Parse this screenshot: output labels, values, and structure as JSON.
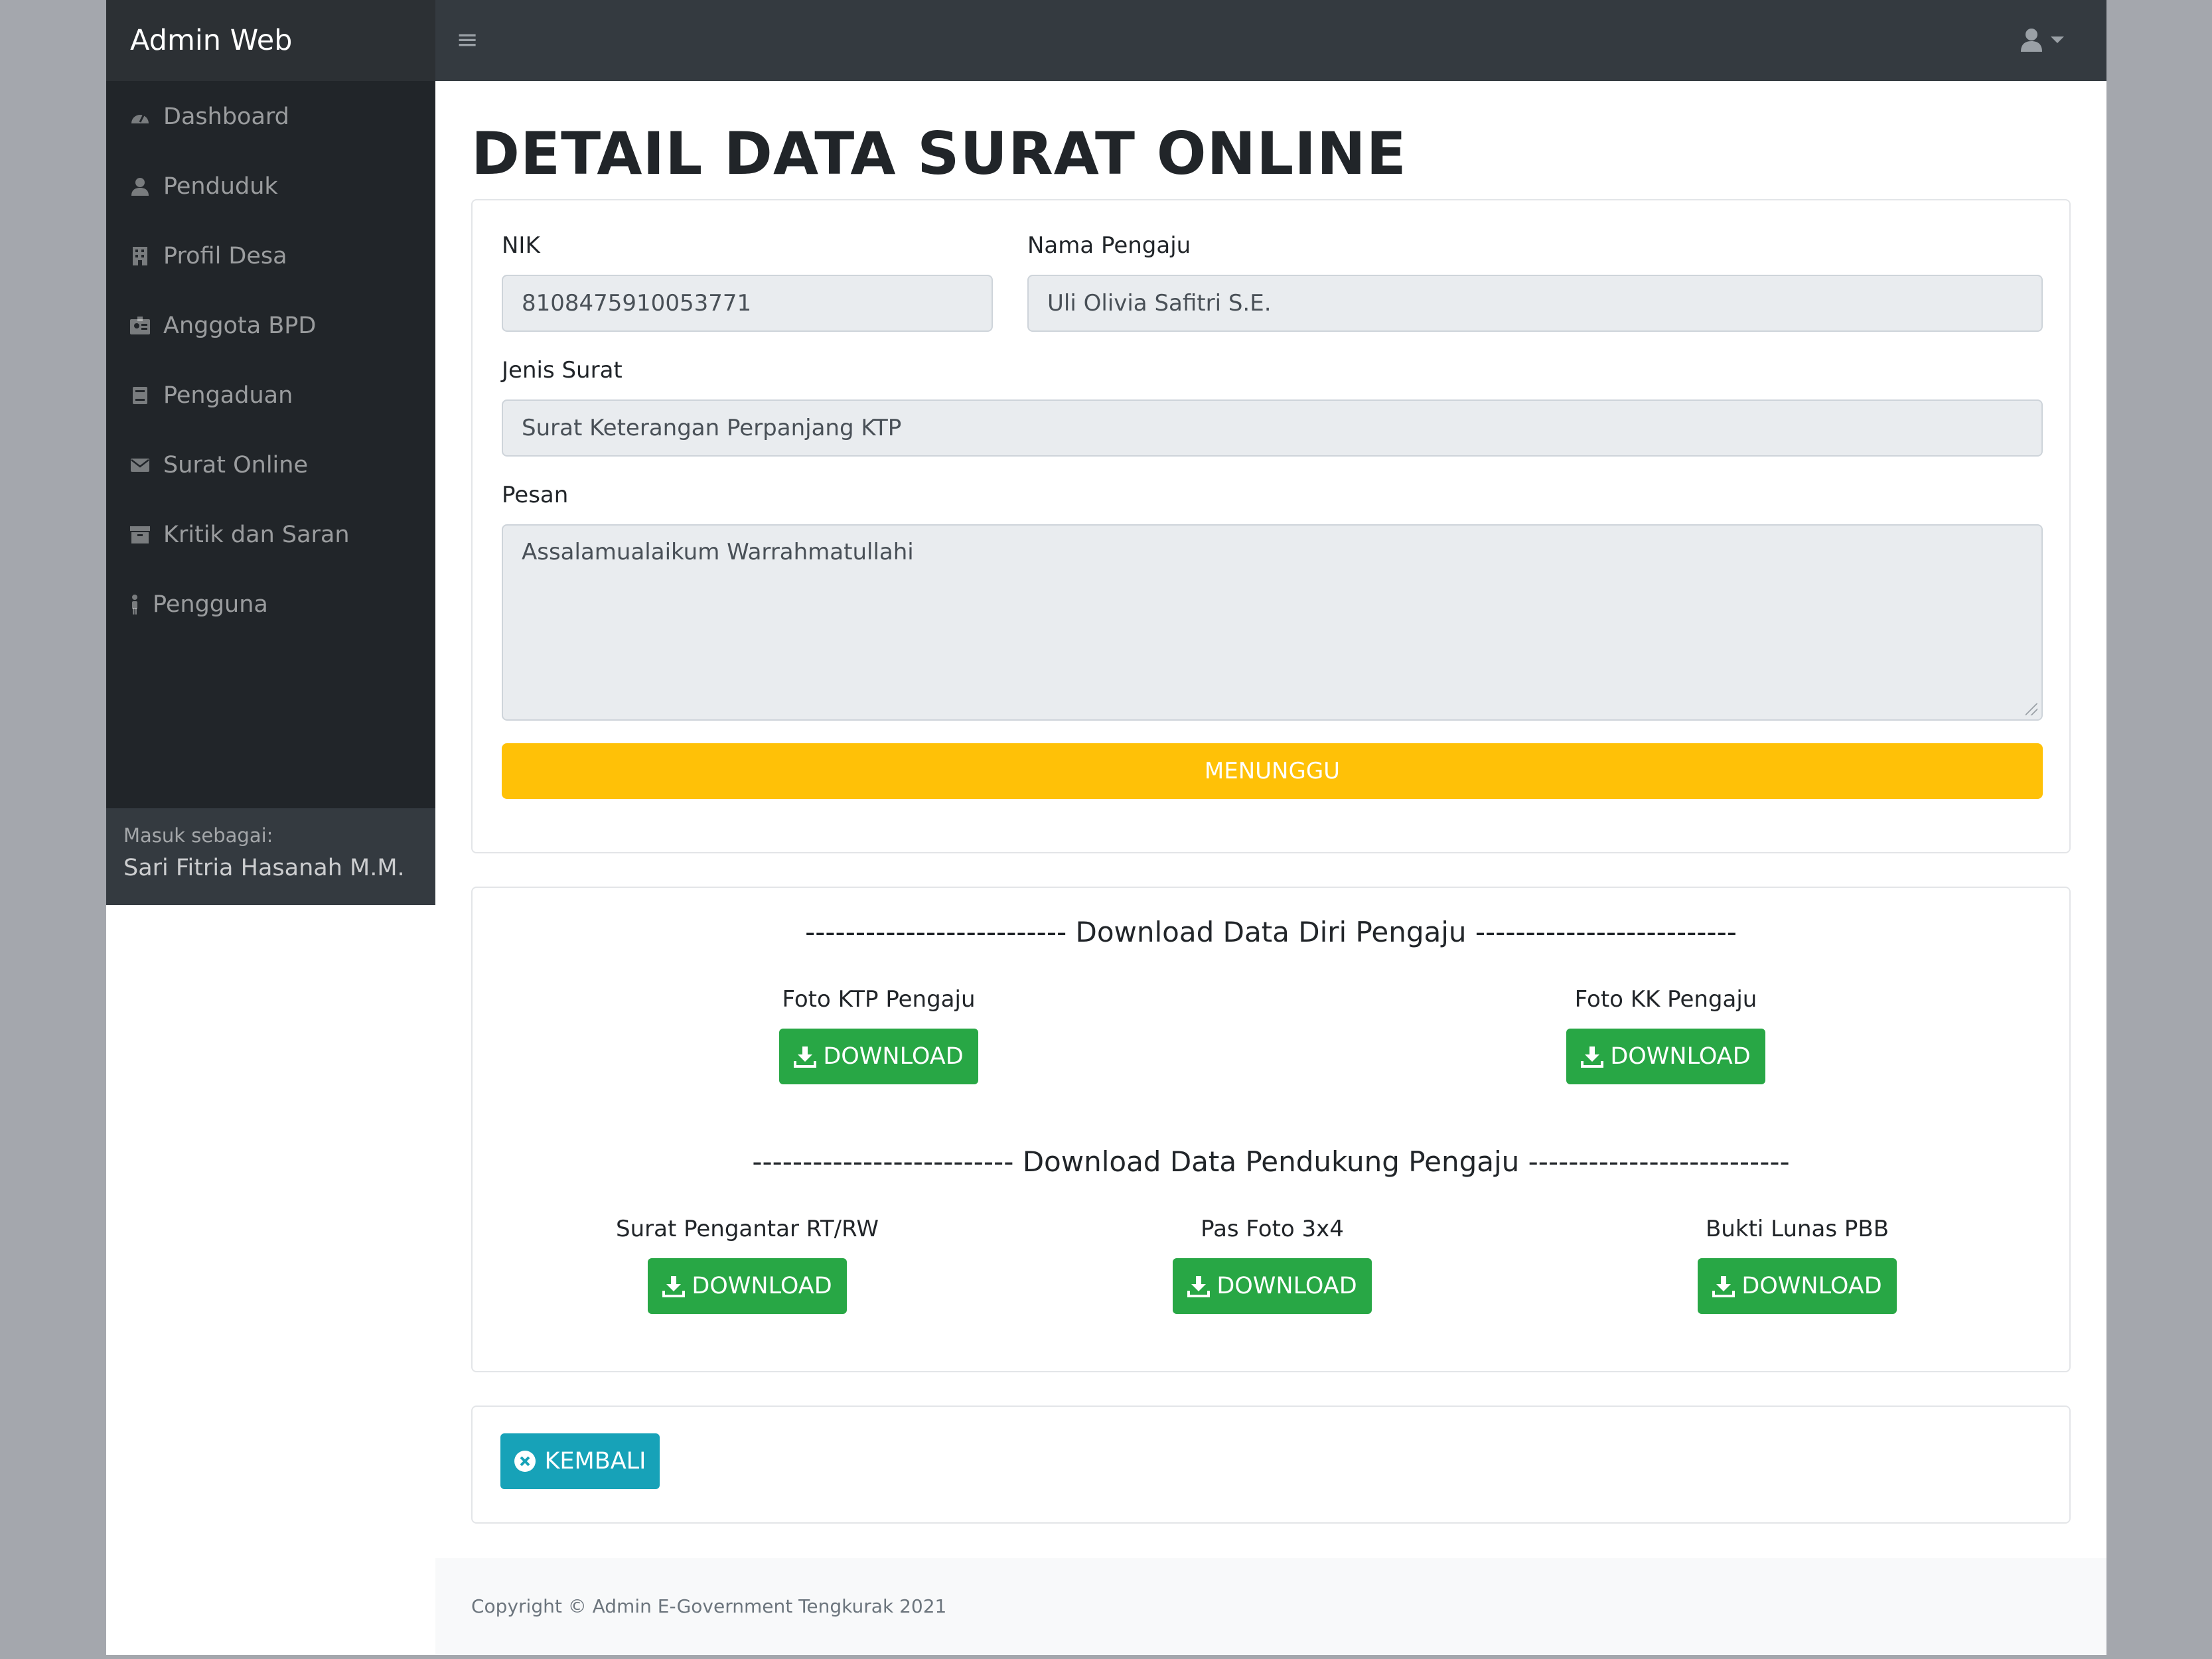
{
  "app": {
    "brand": "Admin Web",
    "menu_icon": "hamburger-icon",
    "user_icon": "user-icon"
  },
  "sidebar": {
    "items": [
      {
        "label": "Dashboard",
        "icon": "gauge-icon"
      },
      {
        "label": "Penduduk",
        "icon": "user-icon"
      },
      {
        "label": "Profil Desa",
        "icon": "building-icon"
      },
      {
        "label": "Anggota BPD",
        "icon": "id-badge-icon"
      },
      {
        "label": "Pengaduan",
        "icon": "book-icon"
      },
      {
        "label": "Surat Online",
        "icon": "envelope-icon"
      },
      {
        "label": "Kritik dan Saran",
        "icon": "archive-icon"
      },
      {
        "label": "Pengguna",
        "icon": "person-icon"
      }
    ],
    "footer_label": "Masuk sebagai:",
    "footer_user": "Sari Fitria Hasanah M.M."
  },
  "page": {
    "title": "DETAIL DATA SURAT ONLINE"
  },
  "form": {
    "nik_label": "NIK",
    "nik_value": "8108475910053771",
    "nama_label": "Nama Pengaju",
    "nama_value": "Uli Olivia Safitri S.E.",
    "jenis_label": "Jenis Surat",
    "jenis_value": "Surat Keterangan Perpanjang KTP",
    "pesan_label": "Pesan",
    "pesan_value": "Assalamualaikum Warrahmatullahi",
    "status_label": "MENUNGGU"
  },
  "downloads": {
    "section1_title": "-------------------------- Download Data Diri Pengaju --------------------------",
    "section2_title": "-------------------------- Download Data Pendukung Pengaju --------------------------",
    "button_label": "DOWNLOAD",
    "items1": [
      {
        "label": "Foto KTP Pengaju"
      },
      {
        "label": "Foto KK Pengaju"
      }
    ],
    "items2": [
      {
        "label": "Surat Pengantar RT/RW"
      },
      {
        "label": "Pas Foto 3x4"
      },
      {
        "label": "Bukti Lunas PBB"
      }
    ]
  },
  "actions": {
    "back_label": "KEMBALI"
  },
  "footer": {
    "copyright": "Copyright © Admin E-Government Tengkurak 2021"
  },
  "colors": {
    "topbar": "#343a40",
    "sidebar": "#212529",
    "warning": "#ffc107",
    "success": "#28a745",
    "info": "#17a2b8"
  }
}
